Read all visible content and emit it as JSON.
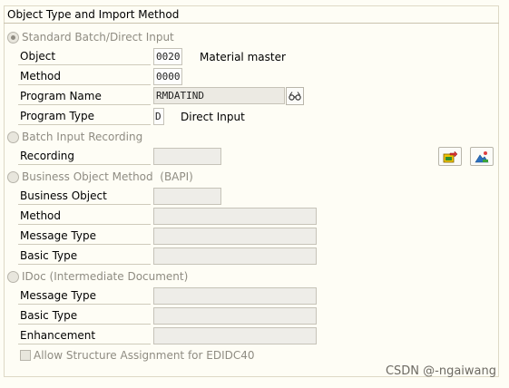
{
  "frame": {
    "title": "Object Type and Import Method"
  },
  "standard": {
    "radio_label": "Standard Batch/Direct Input",
    "selected": true,
    "object": {
      "label": "Object",
      "value": "0020",
      "text": "Material master"
    },
    "method": {
      "label": "Method",
      "value": "0000"
    },
    "program_name": {
      "label": "Program Name",
      "value": "RMDATIND"
    },
    "program_type": {
      "label": "Program Type",
      "value": "D",
      "text": "Direct Input"
    }
  },
  "batch_input": {
    "radio_label": "Batch Input Recording",
    "recording": {
      "label": "Recording",
      "value": ""
    }
  },
  "bapi": {
    "radio_label": "Business Object Method  (BAPI)",
    "business_object": {
      "label": "Business Object",
      "value": ""
    },
    "method": {
      "label": "Method",
      "value": ""
    },
    "message_type": {
      "label": "Message Type",
      "value": ""
    },
    "basic_type": {
      "label": "Basic Type",
      "value": ""
    }
  },
  "idoc": {
    "radio_label": "IDoc (Intermediate Document)",
    "message_type": {
      "label": "Message Type",
      "value": ""
    },
    "basic_type": {
      "label": "Basic Type",
      "value": ""
    },
    "enhancement": {
      "label": "Enhancement",
      "value": ""
    }
  },
  "allow_structure": {
    "label": "Allow Structure Assignment for EDIDC40",
    "checked": false
  },
  "watermark": "CSDN @-ngaiwang"
}
